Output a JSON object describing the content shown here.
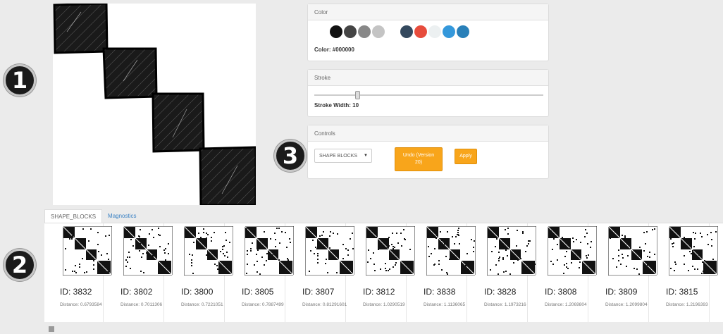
{
  "badges": [
    "1",
    "2",
    "3"
  ],
  "color_panel": {
    "title": "Color",
    "label": "Color: #000000",
    "swatches": [
      "#111111",
      "#444444",
      "#888888",
      "#c4c4c4",
      "#34495e",
      "#e74c3c",
      "#ecf0f1",
      "#3498db",
      "#2980b9"
    ]
  },
  "stroke_panel": {
    "title": "Stroke",
    "label": "Stroke Width: 10",
    "value": 10
  },
  "controls_panel": {
    "title": "Controls",
    "dropdown_value": "SHAPE BLOCKS",
    "undo_label": "Undo (Version 20)",
    "apply_label": "Apply"
  },
  "tabs": [
    {
      "label": "SHAPE_BLOCKS",
      "active": true
    },
    {
      "label": "Magnostics",
      "active": false
    }
  ],
  "results": [
    {
      "id": "ID: 3832",
      "distance": "Distance: 0.6793584"
    },
    {
      "id": "ID: 3802",
      "distance": "Distance: 0.7011306"
    },
    {
      "id": "ID: 3800",
      "distance": "Distance: 0.7221051"
    },
    {
      "id": "ID: 3805",
      "distance": "Distance: 0.7887499"
    },
    {
      "id": "ID: 3807",
      "distance": "Distance: 0.81291601"
    },
    {
      "id": "ID: 3812",
      "distance": "Distance: 1.0290519"
    },
    {
      "id": "ID: 3838",
      "distance": "Distance: 1.1136065"
    },
    {
      "id": "ID: 3828",
      "distance": "Distance: 1.1973216"
    },
    {
      "id": "ID: 3808",
      "distance": "Distance: 1.2069804"
    },
    {
      "id": "ID: 3809",
      "distance": "Distance: 1.2099804"
    },
    {
      "id": "ID: 3815",
      "distance": "Distance: 1.2196393"
    }
  ]
}
